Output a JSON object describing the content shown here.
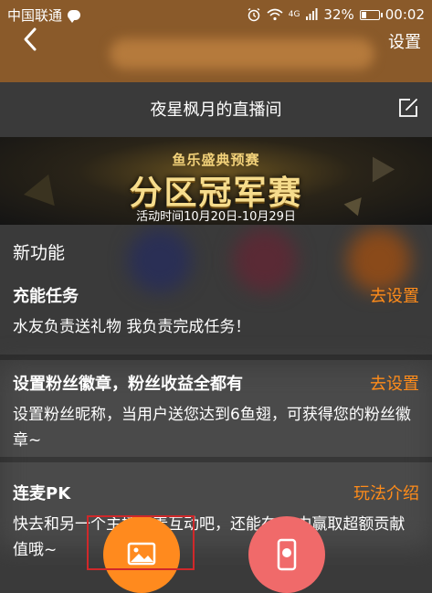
{
  "status_bar": {
    "carrier": "中国联通",
    "signal_label": "4G",
    "battery_percent": "32%",
    "battery_level": 0.32,
    "time": "00:02"
  },
  "header": {
    "settings_label": "设置"
  },
  "room": {
    "title": "夜星枫月的直播间"
  },
  "banner": {
    "top_text": "鱼乐盛典预赛",
    "main_text": "分区冠军赛",
    "date_text": "活动时间10月20日-10月29日"
  },
  "section": {
    "label": "新功能"
  },
  "features": [
    {
      "title": "充能任务",
      "action": "去设置",
      "desc": "水友负责送礼物 我负责完成任务！"
    },
    {
      "title": "设置粉丝徽章，粉丝收益全都有",
      "action": "去设置",
      "desc": "设置粉丝昵称，当用户送您达到6鱼翅，可获得您的粉丝徽章~"
    },
    {
      "title": "连麦PK",
      "action": "玩法介绍",
      "desc": "快去和另一个主播连麦互动吧，还能在PK中赢取超额贡献值哦~"
    }
  ],
  "colors": {
    "accent": "#ff8c1a",
    "image_button": "#ff8a1e",
    "phone_button": "#f06a6a",
    "selection_box": "#d0282a"
  },
  "icons": {
    "back": "back-arrow-icon",
    "edit": "edit-icon",
    "image": "image-icon",
    "phone": "phone-icon"
  }
}
